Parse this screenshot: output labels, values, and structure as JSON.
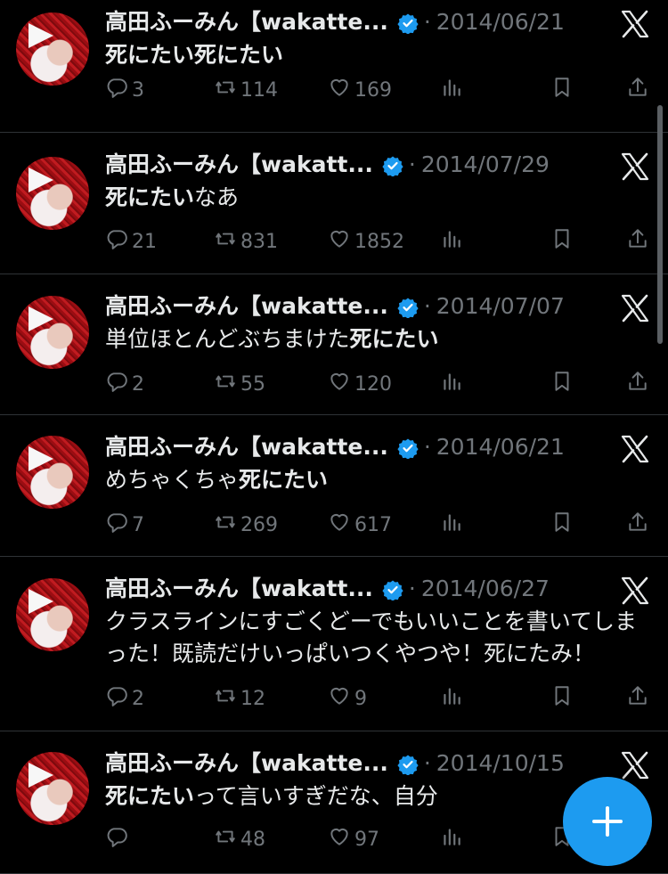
{
  "tweets": [
    {
      "author": "高田ふーみん【wakatte...",
      "date": "2014/06/21",
      "text_parts": [
        {
          "t": "死にたい死にたい",
          "b": true
        }
      ],
      "replies": "3",
      "retweets": "114",
      "likes": "169"
    },
    {
      "author": "高田ふーみん【wakatt...",
      "date": "2014/07/29",
      "text_parts": [
        {
          "t": "死にたい",
          "b": true
        },
        {
          "t": "なあ",
          "b": false
        }
      ],
      "replies": "21",
      "retweets": "831",
      "likes": "1852"
    },
    {
      "author": "高田ふーみん【wakatte...",
      "date": "2014/07/07",
      "text_parts": [
        {
          "t": "単位ほとんどぶちまけた",
          "b": false
        },
        {
          "t": "死にたい",
          "b": true
        }
      ],
      "replies": "2",
      "retweets": "55",
      "likes": "120"
    },
    {
      "author": "高田ふーみん【wakatte...",
      "date": "2014/06/21",
      "text_parts": [
        {
          "t": "めちゃくちゃ",
          "b": false
        },
        {
          "t": "死にたい",
          "b": true
        }
      ],
      "replies": "7",
      "retweets": "269",
      "likes": "617"
    },
    {
      "author": "高田ふーみん【wakatt...",
      "date": "2014/06/27",
      "text_parts": [
        {
          "t": "クラスラインにすごくどーでもいいことを書いてしまった！既読だけいっぱいつくやつや！死にたみ！",
          "b": false
        }
      ],
      "replies": "2",
      "retweets": "12",
      "likes": "9"
    },
    {
      "author": "高田ふーみん【wakatte...",
      "date": "2014/10/15",
      "text_parts": [
        {
          "t": "死にたい",
          "b": true
        },
        {
          "t": "って言いすぎだな、自分",
          "b": false
        }
      ],
      "replies": "",
      "retweets": "48",
      "likes": "97"
    }
  ],
  "separator": "·",
  "colors": {
    "background": "#000000",
    "text": "#e7e9ea",
    "muted": "#71767b",
    "verified": "#1d9bf0",
    "fab": "#1d9bf0",
    "divider": "#2f3336"
  },
  "icons": [
    "reply-icon",
    "retweet-icon",
    "like-icon",
    "views-icon",
    "bookmark-icon",
    "share-icon",
    "verified-badge-icon",
    "x-logo-icon",
    "compose-plus-icon"
  ]
}
